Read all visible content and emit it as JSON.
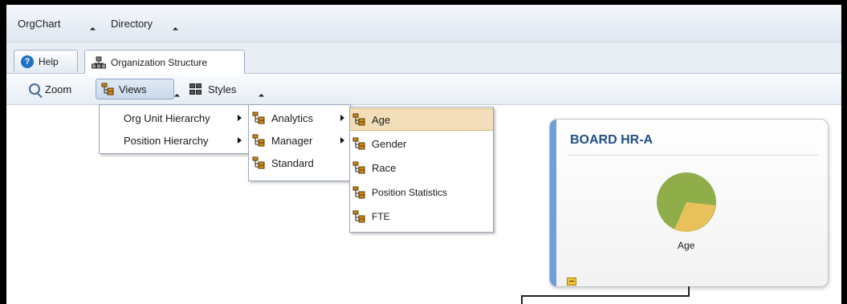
{
  "menubar": {
    "items": [
      "OrgChart",
      "Directory"
    ]
  },
  "tabs": [
    {
      "label": "Help",
      "icon": "help-icon"
    },
    {
      "label": "Organization Structure",
      "icon": "org-structure-icon"
    }
  ],
  "toolbar": {
    "zoom": "Zoom",
    "views": "Views",
    "styles": "Styles"
  },
  "views_menu": [
    "Org Unit Hierarchy",
    "Position Hierarchy"
  ],
  "submenu": [
    "Analytics",
    "Manager",
    "Standard"
  ],
  "analytics_menu": [
    "Age",
    "Gender",
    "Race",
    "Position Statistics",
    "FTE"
  ],
  "card": {
    "title": "BOARD HR-A",
    "chart_label": "Age"
  },
  "colors": {
    "accent": "#1f4f87",
    "highlight": "#f2dfb9",
    "pie_green": "#8fae4a",
    "pie_yellow": "#e9c15a",
    "card_bar": "#6f9fd8"
  }
}
